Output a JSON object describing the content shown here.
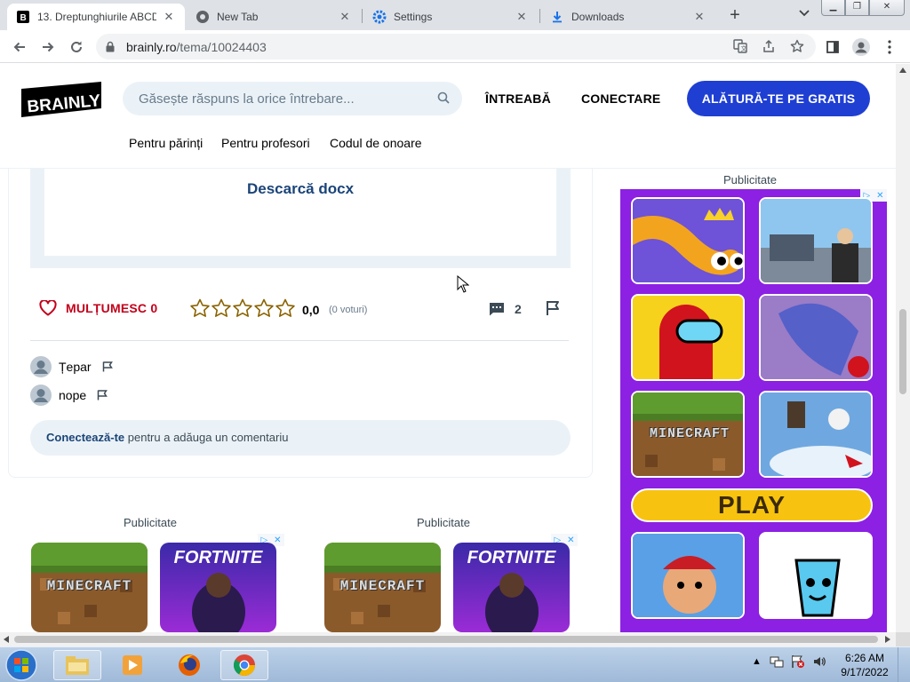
{
  "browser": {
    "tabs": [
      {
        "title": "13. Dreptunghiurile ABCD",
        "favicon": "brainly-icon",
        "active": true
      },
      {
        "title": "New Tab",
        "favicon": "chrome-icon",
        "active": false
      },
      {
        "title": "Settings",
        "favicon": "gear-icon",
        "active": false
      },
      {
        "title": "Downloads",
        "favicon": "download-icon",
        "active": false
      }
    ],
    "url_host": "brainly.ro",
    "url_path": "/tema/10024403"
  },
  "site": {
    "logo_text": "BRAINLY",
    "search_placeholder": "Găsește răspuns la orice întrebare...",
    "ask": "ÎNTREABĂ",
    "login": "CONECTARE",
    "join": "ALĂTURĂ-TE PE GRATIS",
    "subnav": [
      "Pentru părinți",
      "Pentru profesori",
      "Codul de onoare"
    ]
  },
  "answer": {
    "download_label": "Descarcă docx",
    "thanks_label": "MULȚUMESC",
    "thanks_count": "0",
    "stars": 0,
    "rating": "0,0",
    "votes": "(0 voturi)",
    "comment_count": "2",
    "comments": [
      {
        "author": "Țepar"
      },
      {
        "author": "nope"
      }
    ],
    "add_comment_link": "Conectează-te",
    "add_comment_rest": " pentru a adăuga un comentariu"
  },
  "ads": {
    "label": "Publicitate",
    "tiles": [
      "MINECRAFT",
      "FORTNITE"
    ],
    "play_label": "PLAY"
  },
  "taskbar": {
    "time": "6:26 AM",
    "date": "9/17/2022"
  },
  "colors": {
    "brand_blue": "#1f3fd3",
    "thanks_red": "#c3001a",
    "ad_purple": "#8c20e3",
    "link_navy": "#1a4478"
  }
}
